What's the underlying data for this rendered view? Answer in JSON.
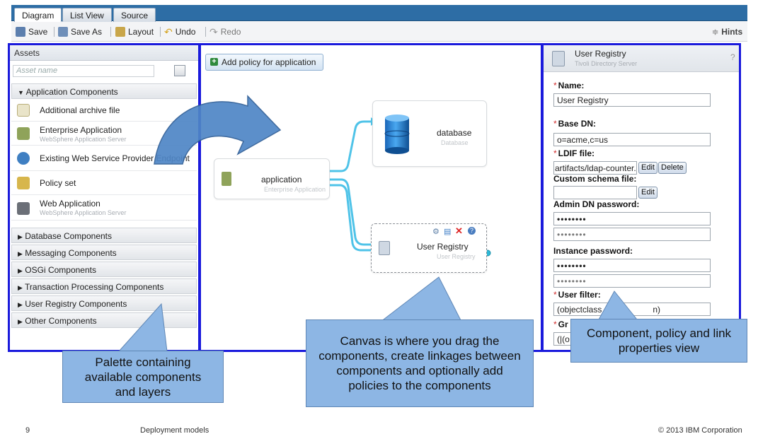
{
  "tabs": [
    {
      "label": "Diagram",
      "active": true
    },
    {
      "label": "List View",
      "active": false
    },
    {
      "label": "Source",
      "active": false
    }
  ],
  "toolbar": {
    "save": "Save",
    "save_as": "Save As",
    "layout": "Layout",
    "undo": "Undo",
    "redo": "Redo",
    "hints": "Hints"
  },
  "palette": {
    "title": "Assets",
    "search_placeholder": "Asset name",
    "categories": [
      {
        "label": "Application Components",
        "expanded": true
      },
      {
        "label": "Database Components",
        "expanded": false
      },
      {
        "label": "Messaging Components",
        "expanded": false
      },
      {
        "label": "OSGi Components",
        "expanded": false
      },
      {
        "label": "Transaction Processing Components",
        "expanded": false
      },
      {
        "label": "User Registry Components",
        "expanded": false
      },
      {
        "label": "Other Components",
        "expanded": false
      }
    ],
    "items": [
      {
        "label": "Additional archive file",
        "sub": "",
        "icon": "archive-file-icon"
      },
      {
        "label": "Enterprise Application",
        "sub": "WebSphere Application Server",
        "icon": "enterprise-app-icon"
      },
      {
        "label": "Existing Web Service Provider Endpoint",
        "sub": "",
        "icon": "web-service-icon"
      },
      {
        "label": "Policy set",
        "sub": "",
        "icon": "policy-set-icon"
      },
      {
        "label": "Web Application",
        "sub": "WebSphere Application Server",
        "icon": "web-app-icon"
      }
    ]
  },
  "canvas": {
    "add_policy_label": "Add policy for application",
    "nodes": {
      "application": {
        "name": "application",
        "type": "Enterprise Application"
      },
      "database": {
        "name": "database",
        "type": "Database"
      },
      "user_registry": {
        "name": "User Registry",
        "type": "User Registry"
      }
    }
  },
  "properties": {
    "title": "User Registry",
    "subtitle": "Tivoli Directory Server",
    "help": "?",
    "fields": {
      "name_label": "Name:",
      "name_value": "User Registry",
      "base_dn_label": "Base DN:",
      "base_dn_value": "o=acme,c=us",
      "ldif_label": "LDIF file:",
      "ldif_value": "artifacts/ldap-counter.l",
      "edit": "Edit",
      "delete": "Delete",
      "custom_schema_label": "Custom schema file:",
      "admin_dn_password_label": "Admin DN password:",
      "password_mask": "••••••••",
      "instance_password_label": "Instance password:",
      "user_filter_label": "User filter:",
      "user_filter_value": "(objectclass",
      "user_filter_value_end": "n)",
      "group_filter_label": "Gr",
      "group_filter_value": "(|(o"
    }
  },
  "callouts": {
    "palette": "Palette containing available components and layers",
    "canvas": "Canvas is where you drag the components, create linkages between components and optionally add policies to the components",
    "properties": "Component, policy and link properties view"
  },
  "footer": {
    "page": "9",
    "title": "Deployment models",
    "copyright": "© 2013 IBM Corporation"
  },
  "colors": {
    "panel_border": "#1a1adc",
    "tab_bar": "#2d6da5",
    "callout_fill": "#8db6e4",
    "link": "#4fc3e8"
  }
}
